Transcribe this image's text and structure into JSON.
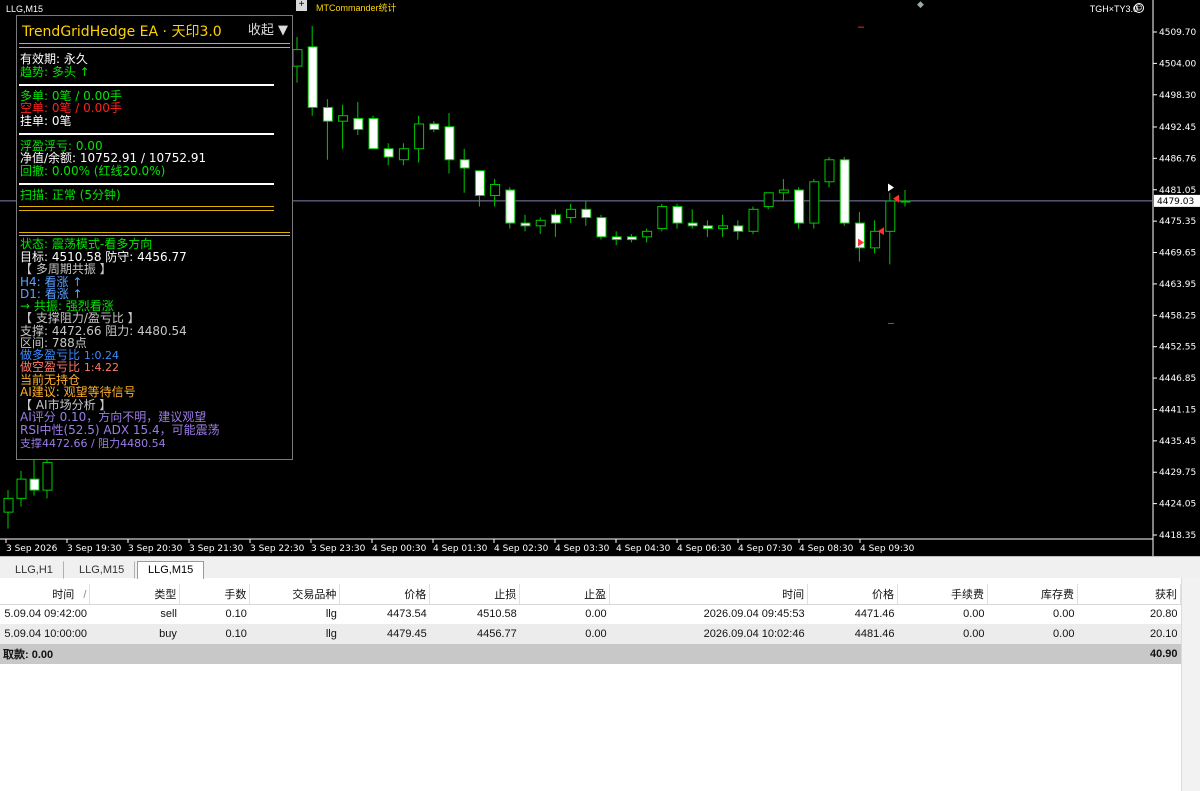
{
  "chart": {
    "symbol_label": "LLG,M15",
    "plus_label": "+",
    "mtcommander_label": "MTCommander统计",
    "account_label": "TGH×TY3.0",
    "smiley_icon": "smiley-icon",
    "current_price": "4479.03",
    "colors": {
      "background": "#000000",
      "bull": "#ffffff",
      "candle_outline": "#00c800",
      "price_line": "#7f7fb0",
      "axis_text": "#ffffff"
    }
  },
  "ea_panel": {
    "title": "TrendGridHedge EA · 天印3.0",
    "collapse_label": "收起 ▼",
    "validity": "有效期: 永久",
    "trend": "趋势: 多头 ↑",
    "long_orders": "多单: 0笔 / 0.00手",
    "short_orders": "空单: 0笔 / 0.00手",
    "pending_orders": "挂单: 0笔",
    "floating_pl": "浮盈浮亏: 0.00",
    "equity_balance": "净值/余额: 10752.91 / 10752.91",
    "drawdown": "回撤: 0.00% (红线20.0%)",
    "scan": "扫描: 正常 (5分钟)",
    "state": "状态: 震荡模式-看多方向",
    "target_guard": "目标: 4510.58  防守: 4456.77",
    "multi_tf_header": "【 多周期共振 】",
    "h4": "H4: 看涨 ↑",
    "d1": "D1: 看涨 ↑",
    "resonance": "→ 共振: 强烈看涨",
    "sr_header": "【 支撑阻力/盈亏比 】",
    "support_resistance": "支撑: 4472.66  阻力: 4480.54",
    "range": "区间: 788点",
    "long_rr_label": "做多盈亏比",
    "long_rr_value": "1:0.24",
    "short_rr_label": "做空盈亏比",
    "short_rr_value": "1:4.22",
    "no_position": "当前无持仓",
    "ai_advice": "AI建议: 观望等待信号",
    "ai_header": "【 AI市场分析 】",
    "ai_score": "AI评分 0.10，方向不明，建议观望",
    "rsi_adx": "RSI中性(52.5) ADX 15.4，可能震荡",
    "ai_sr": "支撑4472.66 / 阻力4480.54"
  },
  "price_axis": {
    "labels": [
      "4509.70",
      "4504.00",
      "4498.30",
      "4492.45",
      "4486.76",
      "4481.05",
      "4475.35",
      "4469.65",
      "4463.95",
      "4458.25",
      "4452.55",
      "4446.85",
      "4441.15",
      "4435.45",
      "4429.75",
      "4424.05",
      "4418.35"
    ]
  },
  "time_axis": {
    "labels": [
      "3 Sep 2026",
      "3 Sep 19:30",
      "3 Sep 20:30",
      "3 Sep 21:30",
      "3 Sep 22:30",
      "3 Sep 23:30",
      "4 Sep 00:30",
      "4 Sep 01:30",
      "4 Sep 02:30",
      "4 Sep 03:30",
      "4 Sep 04:30",
      "4 Sep 06:30",
      "4 Sep 07:30",
      "4 Sep 08:30",
      "4 Sep 09:30"
    ]
  },
  "candles": [
    {
      "o": 4422.5,
      "h": 4426.5,
      "l": 4419.5,
      "c": 4425.0
    },
    {
      "o": 4425.0,
      "h": 4430.0,
      "l": 4423.5,
      "c": 4428.5
    },
    {
      "o": 4428.5,
      "h": 4433.0,
      "l": 4425.5,
      "c": 4426.5
    },
    {
      "o": 4426.5,
      "h": 4432.0,
      "l": 4425.0,
      "c": 4431.5
    },
    {
      "o": 4503.5,
      "h": 4508.8,
      "l": 4500.5,
      "c": 4506.5
    },
    {
      "o": 4507.0,
      "h": 4510.8,
      "l": 4494.5,
      "c": 4496.0
    },
    {
      "o": 4496.0,
      "h": 4497.5,
      "l": 4486.5,
      "c": 4493.5
    },
    {
      "o": 4493.5,
      "h": 4496.5,
      "l": 4488.5,
      "c": 4494.5
    },
    {
      "o": 4494.0,
      "h": 4497.0,
      "l": 4491.0,
      "c": 4492.0
    },
    {
      "o": 4494.0,
      "h": 4494.5,
      "l": 4489.0,
      "c": 4488.5
    },
    {
      "o": 4488.5,
      "h": 4489.5,
      "l": 4485.5,
      "c": 4487.0
    },
    {
      "o": 4486.5,
      "h": 4489.5,
      "l": 4485.5,
      "c": 4488.5
    },
    {
      "o": 4488.5,
      "h": 4494.5,
      "l": 4486.0,
      "c": 4493.0
    },
    {
      "o": 4493.0,
      "h": 4493.5,
      "l": 4491.5,
      "c": 4492.0
    },
    {
      "o": 4492.5,
      "h": 4495.0,
      "l": 4484.0,
      "c": 4486.5
    },
    {
      "o": 4486.5,
      "h": 4488.5,
      "l": 4480.5,
      "c": 4485.0
    },
    {
      "o": 4484.5,
      "h": 4484.5,
      "l": 4478.0,
      "c": 4480.0
    },
    {
      "o": 4480.0,
      "h": 4483.0,
      "l": 4478.0,
      "c": 4482.0
    },
    {
      "o": 4481.0,
      "h": 4481.5,
      "l": 4474.0,
      "c": 4475.0
    },
    {
      "o": 4475.0,
      "h": 4476.5,
      "l": 4473.5,
      "c": 4474.5
    },
    {
      "o": 4474.5,
      "h": 4476.0,
      "l": 4473.0,
      "c": 4475.5
    },
    {
      "o": 4476.5,
      "h": 4477.5,
      "l": 4472.5,
      "c": 4475.0
    },
    {
      "o": 4476.0,
      "h": 4478.5,
      "l": 4475.0,
      "c": 4477.5
    },
    {
      "o": 4477.5,
      "h": 4479.0,
      "l": 4474.5,
      "c": 4476.0
    },
    {
      "o": 4476.0,
      "h": 4476.5,
      "l": 4472.0,
      "c": 4472.5
    },
    {
      "o": 4472.5,
      "h": 4473.5,
      "l": 4471.0,
      "c": 4472.0
    },
    {
      "o": 4472.5,
      "h": 4473.0,
      "l": 4471.5,
      "c": 4472.0
    },
    {
      "o": 4472.5,
      "h": 4474.0,
      "l": 4471.5,
      "c": 4473.5
    },
    {
      "o": 4474.0,
      "h": 4478.5,
      "l": 4473.5,
      "c": 4478.0
    },
    {
      "o": 4478.0,
      "h": 4478.5,
      "l": 4474.0,
      "c": 4475.0
    },
    {
      "o": 4475.0,
      "h": 4477.5,
      "l": 4474.0,
      "c": 4474.5
    },
    {
      "o": 4474.5,
      "h": 4475.5,
      "l": 4472.5,
      "c": 4474.0
    },
    {
      "o": 4474.0,
      "h": 4476.5,
      "l": 4472.5,
      "c": 4474.5
    },
    {
      "o": 4474.5,
      "h": 4475.5,
      "l": 4472.0,
      "c": 4473.5
    },
    {
      "o": 4473.5,
      "h": 4478.0,
      "l": 4473.0,
      "c": 4477.5
    },
    {
      "o": 4478.0,
      "h": 4480.5,
      "l": 4477.5,
      "c": 4480.5
    },
    {
      "o": 4480.5,
      "h": 4483.0,
      "l": 4479.0,
      "c": 4481.0
    },
    {
      "o": 4481.0,
      "h": 4481.5,
      "l": 4474.0,
      "c": 4475.0
    },
    {
      "o": 4475.0,
      "h": 4483.0,
      "l": 4474.0,
      "c": 4482.5
    },
    {
      "o": 4482.5,
      "h": 4487.0,
      "l": 4481.5,
      "c": 4486.5
    },
    {
      "o": 4486.5,
      "h": 4487.0,
      "l": 4474.5,
      "c": 4475.0
    },
    {
      "o": 4475.0,
      "h": 4477.0,
      "l": 4468.0,
      "c": 4470.5
    },
    {
      "o": 4470.5,
      "h": 4475.5,
      "l": 4469.5,
      "c": 4473.5
    },
    {
      "o": 4473.5,
      "h": 4480.5,
      "l": 4467.5,
      "c": 4479.0
    },
    {
      "o": 4479.0,
      "h": 4481.0,
      "l": 4478.0,
      "c": 4479.0
    }
  ],
  "terminal": {
    "tabs": [
      "LLG,H1",
      "LLG,M15",
      "LLG,M15"
    ],
    "active_tab": 2,
    "headers": [
      "时间",
      "类型",
      "手数",
      "交易品种",
      "价格",
      "止损",
      "止盈",
      "时间",
      "价格",
      "手续费",
      "库存费",
      "获利"
    ],
    "sort_indicator": "/",
    "rows": [
      [
        "5.09.04 09:42:00",
        "sell",
        "0.10",
        "llg",
        "4473.54",
        "4510.58",
        "0.00",
        "2026.09.04 09:45:53",
        "4471.46",
        "0.00",
        "0.00",
        "20.80"
      ],
      [
        "5.09.04 10:00:00",
        "buy",
        "0.10",
        "llg",
        "4479.45",
        "4456.77",
        "0.00",
        "2026.09.04 10:02:46",
        "4481.46",
        "0.00",
        "0.00",
        "20.10"
      ]
    ],
    "total_label": "取款: 0.00",
    "total_profit": "40.90"
  }
}
